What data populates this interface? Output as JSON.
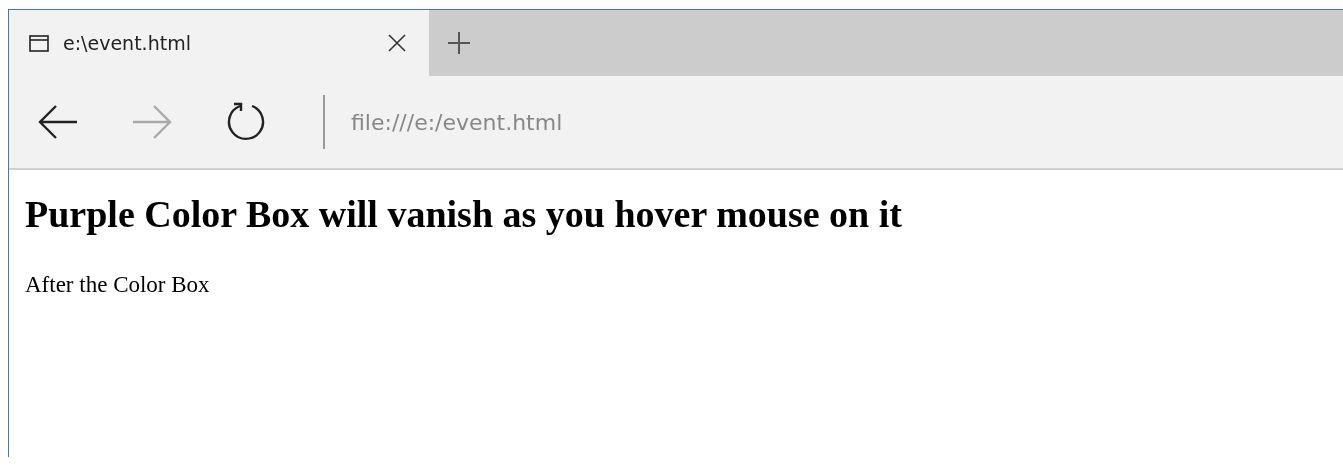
{
  "tabs": [
    {
      "title": "e:\\event.html",
      "selected": true
    }
  ],
  "nav": {
    "back_disabled": false,
    "forward_disabled": true
  },
  "address": {
    "value": "file:///e:/event.html"
  },
  "page": {
    "heading": "Purple Color Box will vanish as you hover mouse on it",
    "paragraph": "After the Color Box"
  }
}
